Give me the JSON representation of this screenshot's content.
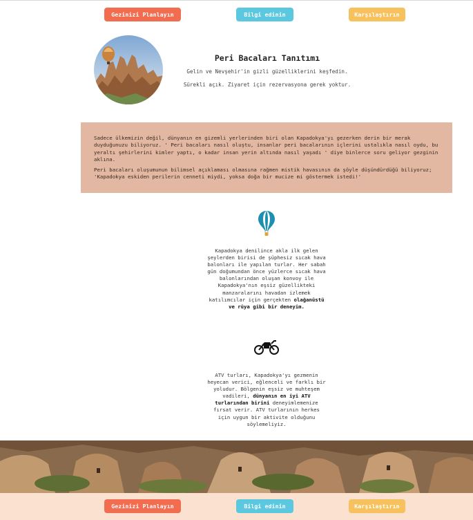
{
  "nav": {
    "plan_label": "Gezinizi Planlayın",
    "info_label": "Bilgi edinin",
    "compare_label": "Karşılaştırın"
  },
  "hero": {
    "title": "Peri Bacaları Tanıtımı",
    "subtitle": "Gelin ve Nevşehir'in gizli güzelliklerini keşfedin.",
    "note": "Sürekli açık. Ziyaret için rezervasyona gerek yoktur."
  },
  "description": {
    "paragraph1": "Sadece ülkemizin değil, dünyanın en gizemli yerlerinden biri olan Kapadokya'yı gezerken derin bir merak duyduğunuzu biliyoruz. ' Peri bacaları nasıl oluştu, insanlar peri bacalarının içlerini ustalıkla nasıl oydu, bu yeraltı şehirlerini kimler yaptı, o kadar insan yerin altında nasıl yaşadı ' diye binlerce soru geliyor gezginin aklına.",
    "paragraph2": "Peri bacaları oluşumunun bilimsel açıklaması olmasına rağmen mistik havasının da şöyle düşündürdüğü biliyoruz; 'Kapadokya eskiden perilerin cenneti miydi, yoksa doğa bir mucize mi göstermek istedi!'"
  },
  "features": {
    "balloon": {
      "icon": "hot-air-balloon-icon",
      "text": "Kapadokya denilince akla ilk gelen şeylerden birisi de şüphesiz sıcak hava balonları ile yapılan turlar. Her sabah gün doğumundan önce yüzlerce sıcak hava balonlarından oluşan konvoy ile Kapadokya'nın eşsiz güzellikteki manzaralarını havadan izlemek katılımcılar için gerçekten",
      "highlight": "olağanüstü ve rüya gibi bir deneyim."
    },
    "atv": {
      "icon": "motorcycle-icon",
      "text_before": "ATV turları, Kapadokya'yı gezmenin heyecan verici, eğlenceli ve farklı bir yoludur. Bölgenin eşsiz ve muhteşem vadileri,",
      "highlight": "dünyanın en iyi ATV turlarından birini",
      "text_after": "deneyimlemenize fırsat verir. ATV turlarının herkes için uygun bir aktivite olduğunu söylemeliyiz."
    }
  },
  "footer_nav": {
    "plan_label": "Gezinizi Planlayın",
    "info_label": "Bilgi edinin",
    "compare_label": "Karşılaştırın"
  },
  "colors": {
    "plan": "#f26c4f",
    "info": "#5bc8e0",
    "compare": "#f7c25d",
    "desc_bg": "#e2b8a2",
    "footer_bg": "#fbe1d0"
  }
}
